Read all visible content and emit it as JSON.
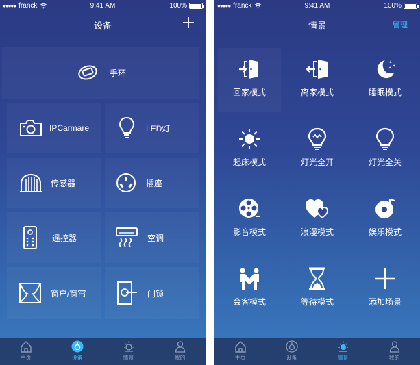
{
  "status_bar": {
    "carrier": "franck",
    "time": "9:41 AM",
    "battery": "100%"
  },
  "devices_screen": {
    "title": "设备",
    "devices": [
      {
        "label": "手环",
        "icon": "band-icon"
      },
      {
        "label": "IPCarmare",
        "icon": "camera-icon"
      },
      {
        "label": "LED灯",
        "icon": "bulb-icon"
      },
      {
        "label": "传感器",
        "icon": "sensor-icon"
      },
      {
        "label": "插座",
        "icon": "socket-icon"
      },
      {
        "label": "遥控器",
        "icon": "remote-icon"
      },
      {
        "label": "空调",
        "icon": "ac-icon"
      },
      {
        "label": "窗户/窗帘",
        "icon": "curtain-icon"
      },
      {
        "label": "门锁",
        "icon": "door-lock-icon"
      }
    ]
  },
  "scenes_screen": {
    "title": "情景",
    "manage_label": "管理",
    "scenes": [
      {
        "label": "回家模式",
        "icon": "enter-door-icon"
      },
      {
        "label": "离家模式",
        "icon": "exit-door-icon"
      },
      {
        "label": "睡眠模式",
        "icon": "moon-icon"
      },
      {
        "label": "起床模式",
        "icon": "sun-icon"
      },
      {
        "label": "灯光全开",
        "icon": "bulb-on-icon"
      },
      {
        "label": "灯光全关",
        "icon": "bulb-off-icon"
      },
      {
        "label": "影音模式",
        "icon": "film-reel-icon"
      },
      {
        "label": "浪漫模式",
        "icon": "hearts-icon"
      },
      {
        "label": "娱乐模式",
        "icon": "music-disc-icon"
      },
      {
        "label": "会客模式",
        "icon": "handshake-icon"
      },
      {
        "label": "等待模式",
        "icon": "hourglass-icon"
      },
      {
        "label": "添加场景",
        "icon": "add-icon"
      }
    ]
  },
  "tab_bar": {
    "tabs": [
      {
        "label": "主页",
        "icon": "home-icon"
      },
      {
        "label": "设备",
        "icon": "device-icon"
      },
      {
        "label": "情景",
        "icon": "sun-tab-icon"
      },
      {
        "label": "我的",
        "icon": "person-icon"
      }
    ],
    "devices_screen_active": "设备",
    "scenes_screen_active": "情景"
  },
  "colors": {
    "accent": "#3fb6f5",
    "tab_bar_bg": "#25406e",
    "gradient_top": "#2b3a83",
    "gradient_bottom": "#3a7cc2"
  }
}
